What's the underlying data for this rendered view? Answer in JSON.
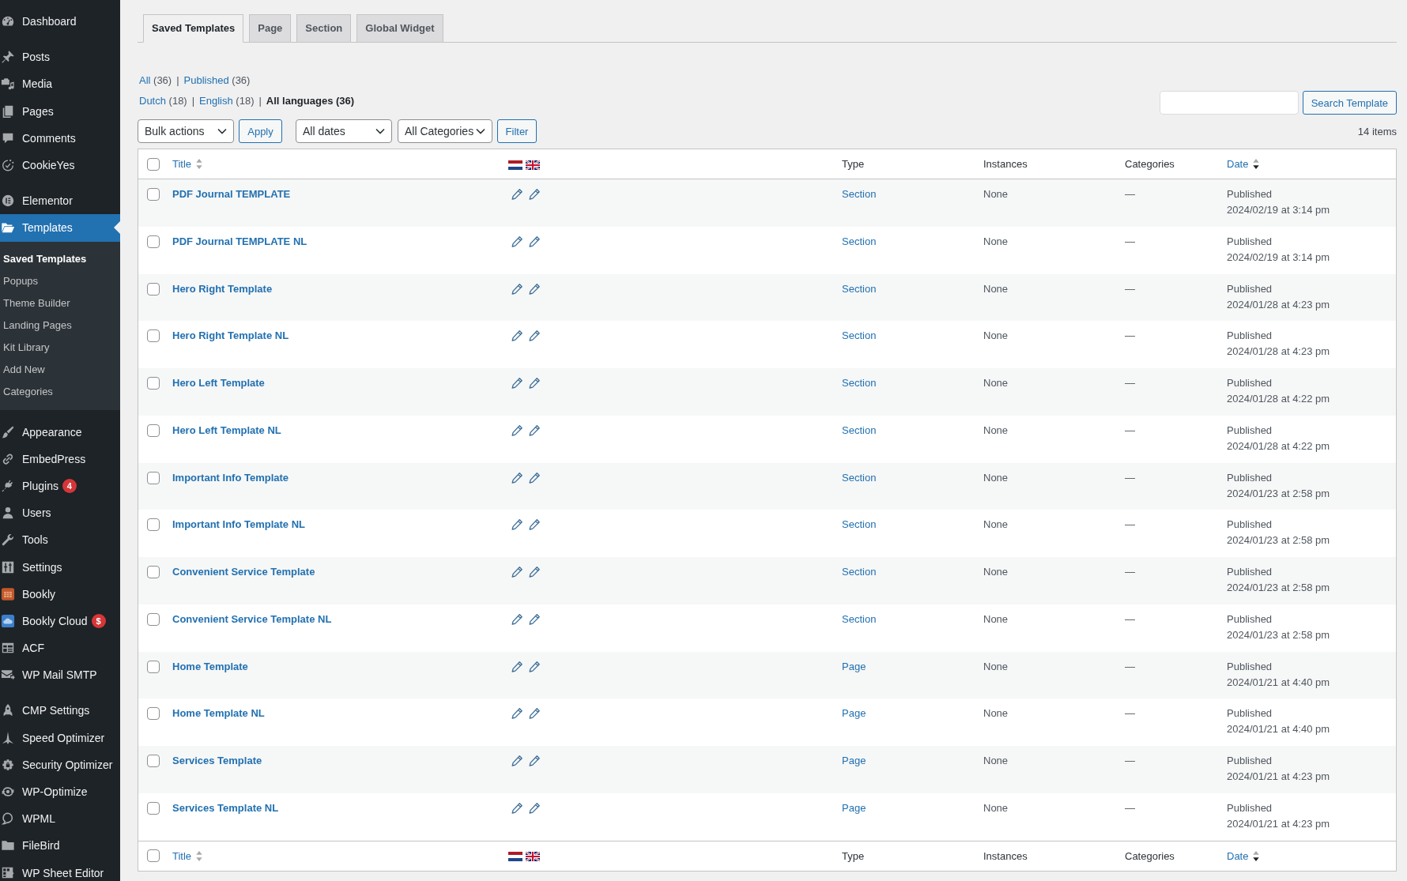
{
  "sidebar": {
    "groups": [
      {
        "items": [
          {
            "label": "Dashboard",
            "selected": false
          }
        ]
      },
      {
        "items": [
          {
            "label": "Posts",
            "selected": false
          },
          {
            "label": "Media",
            "selected": false
          },
          {
            "label": "Pages",
            "selected": false
          },
          {
            "label": "Comments",
            "selected": false
          },
          {
            "label": "CookieYes",
            "selected": false
          }
        ]
      },
      {
        "items": [
          {
            "label": "Elementor",
            "selected": false
          },
          {
            "label": "Templates",
            "selected": true,
            "children": [
              {
                "label": "Saved Templates",
                "selected": true
              },
              {
                "label": "Popups",
                "selected": false
              },
              {
                "label": "Theme Builder",
                "selected": false
              },
              {
                "label": "Landing Pages",
                "selected": false
              },
              {
                "label": "Kit Library",
                "selected": false
              },
              {
                "label": "Add New",
                "selected": false
              },
              {
                "label": "Categories",
                "selected": false
              }
            ]
          }
        ]
      },
      {
        "items": [
          {
            "label": "Appearance",
            "selected": false
          },
          {
            "label": "EmbedPress",
            "selected": false
          },
          {
            "label": "Plugins",
            "selected": false,
            "badge": "4"
          },
          {
            "label": "Users",
            "selected": false
          },
          {
            "label": "Tools",
            "selected": false
          },
          {
            "label": "Settings",
            "selected": false
          },
          {
            "label": "Bookly",
            "selected": false
          },
          {
            "label": "Bookly Cloud",
            "selected": false,
            "badge": "$"
          },
          {
            "label": "ACF",
            "selected": false
          },
          {
            "label": "WP Mail SMTP",
            "selected": false
          }
        ]
      },
      {
        "items": [
          {
            "label": "CMP Settings",
            "selected": false
          },
          {
            "label": "Speed Optimizer",
            "selected": false
          },
          {
            "label": "Security Optimizer",
            "selected": false
          },
          {
            "label": "WP-Optimize",
            "selected": false
          },
          {
            "label": "WPML",
            "selected": false
          },
          {
            "label": "FileBird",
            "selected": false
          },
          {
            "label": "WP Sheet Editor",
            "selected": false
          }
        ]
      }
    ]
  },
  "tabs": [
    {
      "label": "Saved Templates",
      "selected": true
    },
    {
      "label": "Page",
      "selected": false
    },
    {
      "label": "Section",
      "selected": false
    },
    {
      "label": "Global Widget",
      "selected": false
    }
  ],
  "views": {
    "status": [
      {
        "label": "All",
        "count": "(36)",
        "separator": "|",
        "selected": false
      },
      {
        "label": "Published",
        "count": "(36)",
        "selected": false
      }
    ],
    "languages": [
      {
        "label": "Dutch",
        "count": "(18)",
        "separator": "|",
        "selected": false
      },
      {
        "label": "English",
        "count": "(18)",
        "separator": "|",
        "selected": false
      },
      {
        "label": "All languages",
        "count": "(36)",
        "selected": true
      }
    ]
  },
  "search": {
    "button": "Search Template"
  },
  "tablenav": {
    "bulk_actions": "Bulk actions",
    "apply": "Apply",
    "filters": [
      "All dates",
      "All Categories"
    ],
    "filter_button": "Filter",
    "count": "14 items"
  },
  "table": {
    "columns": [
      {
        "kind": "check",
        "checked": false
      },
      {
        "kind": "sortable",
        "label": "Title",
        "sorted_desc": false
      },
      {
        "kind": "flags"
      },
      {
        "kind": "text",
        "label": "Type"
      },
      {
        "kind": "text",
        "label": "Instances"
      },
      {
        "kind": "text",
        "label": "Categories"
      },
      {
        "kind": "sortable",
        "label": "Date",
        "sorted_desc": true
      }
    ],
    "rows": [
      {
        "checked": false,
        "title": "PDF Journal TEMPLATE",
        "type": "Section",
        "instances": "None",
        "categories": "—",
        "status": "Published",
        "date": "2024/02/19 at 3:14 pm"
      },
      {
        "checked": false,
        "title": "PDF Journal TEMPLATE NL",
        "type": "Section",
        "instances": "None",
        "categories": "—",
        "status": "Published",
        "date": "2024/02/19 at 3:14 pm"
      },
      {
        "checked": false,
        "title": "Hero Right Template",
        "type": "Section",
        "instances": "None",
        "categories": "—",
        "status": "Published",
        "date": "2024/01/28 at 4:23 pm"
      },
      {
        "checked": false,
        "title": "Hero Right Template NL",
        "type": "Section",
        "instances": "None",
        "categories": "—",
        "status": "Published",
        "date": "2024/01/28 at 4:23 pm"
      },
      {
        "checked": false,
        "title": "Hero Left Template",
        "type": "Section",
        "instances": "None",
        "categories": "—",
        "status": "Published",
        "date": "2024/01/28 at 4:22 pm"
      },
      {
        "checked": false,
        "title": "Hero Left Template NL",
        "type": "Section",
        "instances": "None",
        "categories": "—",
        "status": "Published",
        "date": "2024/01/28 at 4:22 pm"
      },
      {
        "checked": false,
        "title": "Important Info Template",
        "type": "Section",
        "instances": "None",
        "categories": "—",
        "status": "Published",
        "date": "2024/01/23 at 2:58 pm"
      },
      {
        "checked": false,
        "title": "Important Info Template NL",
        "type": "Section",
        "instances": "None",
        "categories": "—",
        "status": "Published",
        "date": "2024/01/23 at 2:58 pm"
      },
      {
        "checked": false,
        "title": "Convenient Service Template",
        "type": "Section",
        "instances": "None",
        "categories": "—",
        "status": "Published",
        "date": "2024/01/23 at 2:58 pm"
      },
      {
        "checked": false,
        "title": "Convenient Service Template NL",
        "type": "Section",
        "instances": "None",
        "categories": "—",
        "status": "Published",
        "date": "2024/01/23 at 2:58 pm"
      },
      {
        "checked": false,
        "title": "Home Template",
        "type": "Page",
        "instances": "None",
        "categories": "—",
        "status": "Published",
        "date": "2024/01/21 at 4:40 pm"
      },
      {
        "checked": false,
        "title": "Home Template NL",
        "type": "Page",
        "instances": "None",
        "categories": "—",
        "status": "Published",
        "date": "2024/01/21 at 4:40 pm"
      },
      {
        "checked": false,
        "title": "Services Template",
        "type": "Page",
        "instances": "None",
        "categories": "—",
        "status": "Published",
        "date": "2024/01/21 at 4:23 pm"
      },
      {
        "checked": false,
        "title": "Services Template NL",
        "type": "Page",
        "instances": "None",
        "categories": "—",
        "status": "Published",
        "date": "2024/01/21 at 4:23 pm"
      }
    ],
    "footer_columns": [
      {
        "kind": "check",
        "checked": false
      },
      {
        "kind": "sortable",
        "label": "Title",
        "sorted_desc": false
      },
      {
        "kind": "flags"
      },
      {
        "kind": "text",
        "label": "Type"
      },
      {
        "kind": "text",
        "label": "Instances"
      },
      {
        "kind": "text",
        "label": "Categories"
      },
      {
        "kind": "sortable",
        "label": "Date",
        "sorted_desc": true
      }
    ]
  }
}
